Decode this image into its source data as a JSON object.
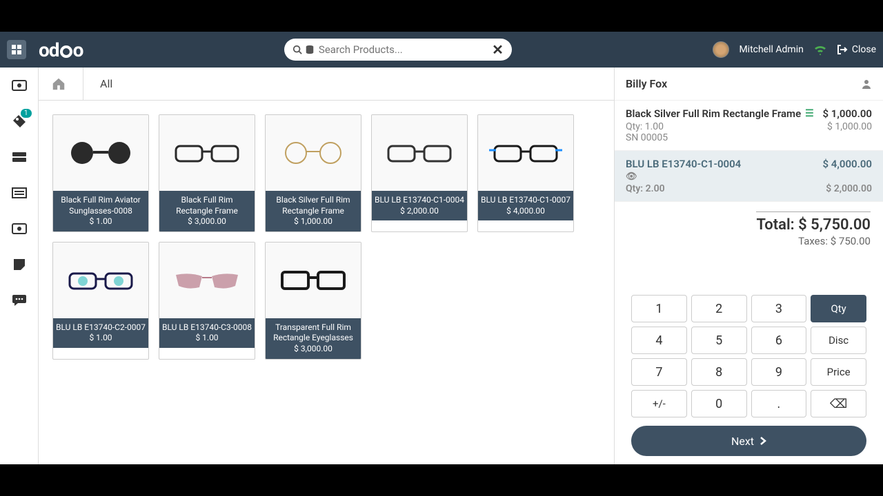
{
  "header": {
    "user_name": "Mitchell Admin",
    "close_label": "Close",
    "search_placeholder": "Search Products..."
  },
  "breadcrumb": {
    "category": "All"
  },
  "products": [
    {
      "name": "Black Full Rim Aviator Sunglasses-0008",
      "price": "$ 1.00"
    },
    {
      "name": "Black Full Rim Rectangle Frame",
      "price": "$ 3,000.00"
    },
    {
      "name": "Black Silver Full Rim Rectangle Frame",
      "price": "$ 1,000.00"
    },
    {
      "name": "BLU LB E13740-C1-0004",
      "price": "$ 2,000.00"
    },
    {
      "name": "BLU LB E13740-C1-0007",
      "price": "$ 4,000.00"
    },
    {
      "name": "BLU LB E13740-C2-0007",
      "price": "$ 1.00"
    },
    {
      "name": "BLU LB E13740-C3-0008",
      "price": "$ 1.00"
    },
    {
      "name": "Transparent Full Rim Rectangle Eyeglasses",
      "price": "$ 3,000.00"
    }
  ],
  "order": {
    "customer": "Billy Fox",
    "lines": [
      {
        "name": "Black Silver Full Rim Rectangle Frame",
        "line_total": "$ 1,000.00",
        "qty": "Qty: 1.00",
        "unit_price": "$ 1,000.00",
        "sn": "SN 00005"
      },
      {
        "name": "BLU LB E13740-C1-0004",
        "line_total": "$ 4,000.00",
        "qty": "Qty: 2.00",
        "unit_price": "$ 2,000.00"
      }
    ],
    "total_label": "Total:",
    "total_value": "$ 5,750.00",
    "taxes_label": "Taxes:",
    "taxes_value": "$ 750.00"
  },
  "keypad": {
    "k1": "1",
    "k2": "2",
    "k3": "3",
    "kqty": "Qty",
    "k4": "4",
    "k5": "5",
    "k6": "6",
    "kdisc": "Disc",
    "k7": "7",
    "k8": "8",
    "k9": "9",
    "kprice": "Price",
    "kpm": "+/-",
    "k0": "0",
    "kdot": ".",
    "kbs": "⌫"
  },
  "footer": {
    "next_label": "Next"
  },
  "rail_badge": "1"
}
